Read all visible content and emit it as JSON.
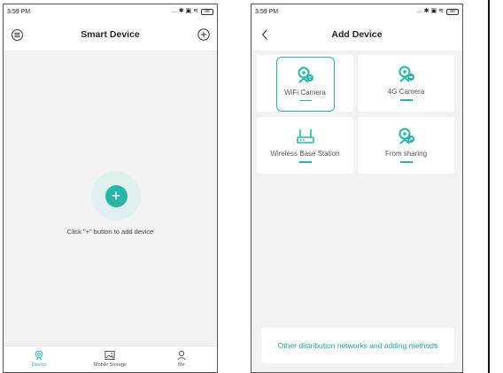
{
  "left_screen": {
    "status": {
      "time": "3:59 PM",
      "icons_text": "... ✱ ▣ ≋",
      "battery": "88"
    },
    "header": {
      "title": "Smart Device",
      "menu_icon": "menu-icon",
      "add_icon": "plus-circle-icon"
    },
    "empty_state": {
      "add_symbol": "+",
      "hint": "Click \"+\" button to add device"
    },
    "tabs": [
      {
        "label": "Device",
        "icon": "camera-icon",
        "active": true
      },
      {
        "label": "Mobile Storage",
        "icon": "image-icon",
        "active": false
      },
      {
        "label": "Me",
        "icon": "person-icon",
        "active": false
      }
    ]
  },
  "right_screen": {
    "status": {
      "time": "3:59 PM",
      "icons_text": "... ✱ ▣ ≋",
      "battery": "88"
    },
    "header": {
      "title": "Add Device",
      "back_icon": "chevron-left-icon"
    },
    "options": [
      {
        "label": "WiFi Camera",
        "icon": "wifi-camera-icon",
        "selected": true
      },
      {
        "label": "4G Camera",
        "icon": "4g-camera-icon",
        "selected": false
      },
      {
        "label": "Wireless Base Station",
        "icon": "base-station-icon",
        "selected": false
      },
      {
        "label": "From sharing",
        "icon": "share-camera-icon",
        "selected": false
      }
    ],
    "footer_link": "Other distribution networks and adding methods"
  },
  "colors": {
    "accent": "#2bb5a6",
    "background": "#f2f2f2",
    "card": "#ffffff",
    "text": "#222222"
  }
}
